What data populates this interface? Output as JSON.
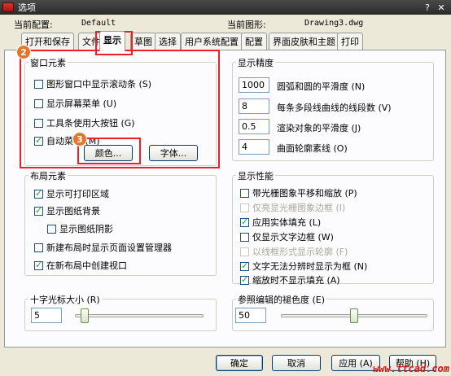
{
  "window": {
    "title": "选项",
    "help": "?",
    "close": "✕"
  },
  "header": {
    "current_profile_label": "当前配置:",
    "current_profile_value": "Default",
    "current_drawing_label": "当前图形:",
    "current_drawing_value": "Drawing3.dwg"
  },
  "tabs": [
    {
      "label": "打开和保存"
    },
    {
      "label": "文件"
    },
    {
      "label": "显示"
    },
    {
      "label": "草图"
    },
    {
      "label": "选择"
    },
    {
      "label": "用户系统配置"
    },
    {
      "label": "配置"
    },
    {
      "label": "界面皮肤和主题"
    },
    {
      "label": "打印"
    }
  ],
  "window_elements": {
    "title": "窗口元素",
    "items": [
      {
        "label": "图形窗口中显示滚动条 (S)",
        "checked": false
      },
      {
        "label": "显示屏幕菜单 (U)",
        "checked": false
      },
      {
        "label": "工具条使用大按钮 (G)",
        "checked": false
      },
      {
        "label": "自动菜单 (M)",
        "checked": true
      }
    ],
    "colors_button": "颜色...",
    "fonts_button": "字体..."
  },
  "layout_elements": {
    "title": "布局元素",
    "items": [
      {
        "label": "显示可打印区域",
        "checked": true
      },
      {
        "label": "显示图纸背景",
        "checked": true
      },
      {
        "label": "显示图纸阴影",
        "checked": false
      },
      {
        "label": "新建布局时显示页面设置管理器",
        "checked": false
      },
      {
        "label": "在新布局中创建视口",
        "checked": true
      }
    ]
  },
  "crosshair": {
    "title": "十字光标大小 (R)",
    "value": "5",
    "level": 0.05
  },
  "display_resolution": {
    "title": "显示精度",
    "items": [
      {
        "value": "1000",
        "label": "圆弧和圆的平滑度 (N)"
      },
      {
        "value": "8",
        "label": "每条多段线曲线的线段数 (V)"
      },
      {
        "value": "0.5",
        "label": "渲染对象的平滑度 (J)"
      },
      {
        "value": "4",
        "label": "曲面轮廓素线 (O)"
      }
    ]
  },
  "display_performance": {
    "title": "显示性能",
    "items": [
      {
        "label": "带光栅图象平移和缩放 (P)",
        "checked": false,
        "disabled": false
      },
      {
        "label": "仅亮显光栅图象边框 (I)",
        "checked": false,
        "disabled": true
      },
      {
        "label": "应用实体填充 (L)",
        "checked": true,
        "disabled": false
      },
      {
        "label": "仅显示文字边框 (W)",
        "checked": false,
        "disabled": false
      },
      {
        "label": "以线框形式显示轮廓 (F)",
        "checked": false,
        "disabled": true
      },
      {
        "label": "文字无法分辨时显示为框 (N)",
        "checked": true,
        "disabled": false
      },
      {
        "label": "缩放时不显示填充 (A)",
        "checked": true,
        "disabled": false
      }
    ]
  },
  "xref_fade": {
    "title": "参照编辑的褪色度 (E)",
    "value": "50",
    "level": 0.5
  },
  "footer": {
    "ok": "确定",
    "cancel": "取消",
    "apply": "应用 (A)",
    "help": "帮助 (H)"
  },
  "annotations": {
    "badge_2": "2",
    "badge_3": "3"
  },
  "watermark": "www.ttcad.com"
}
